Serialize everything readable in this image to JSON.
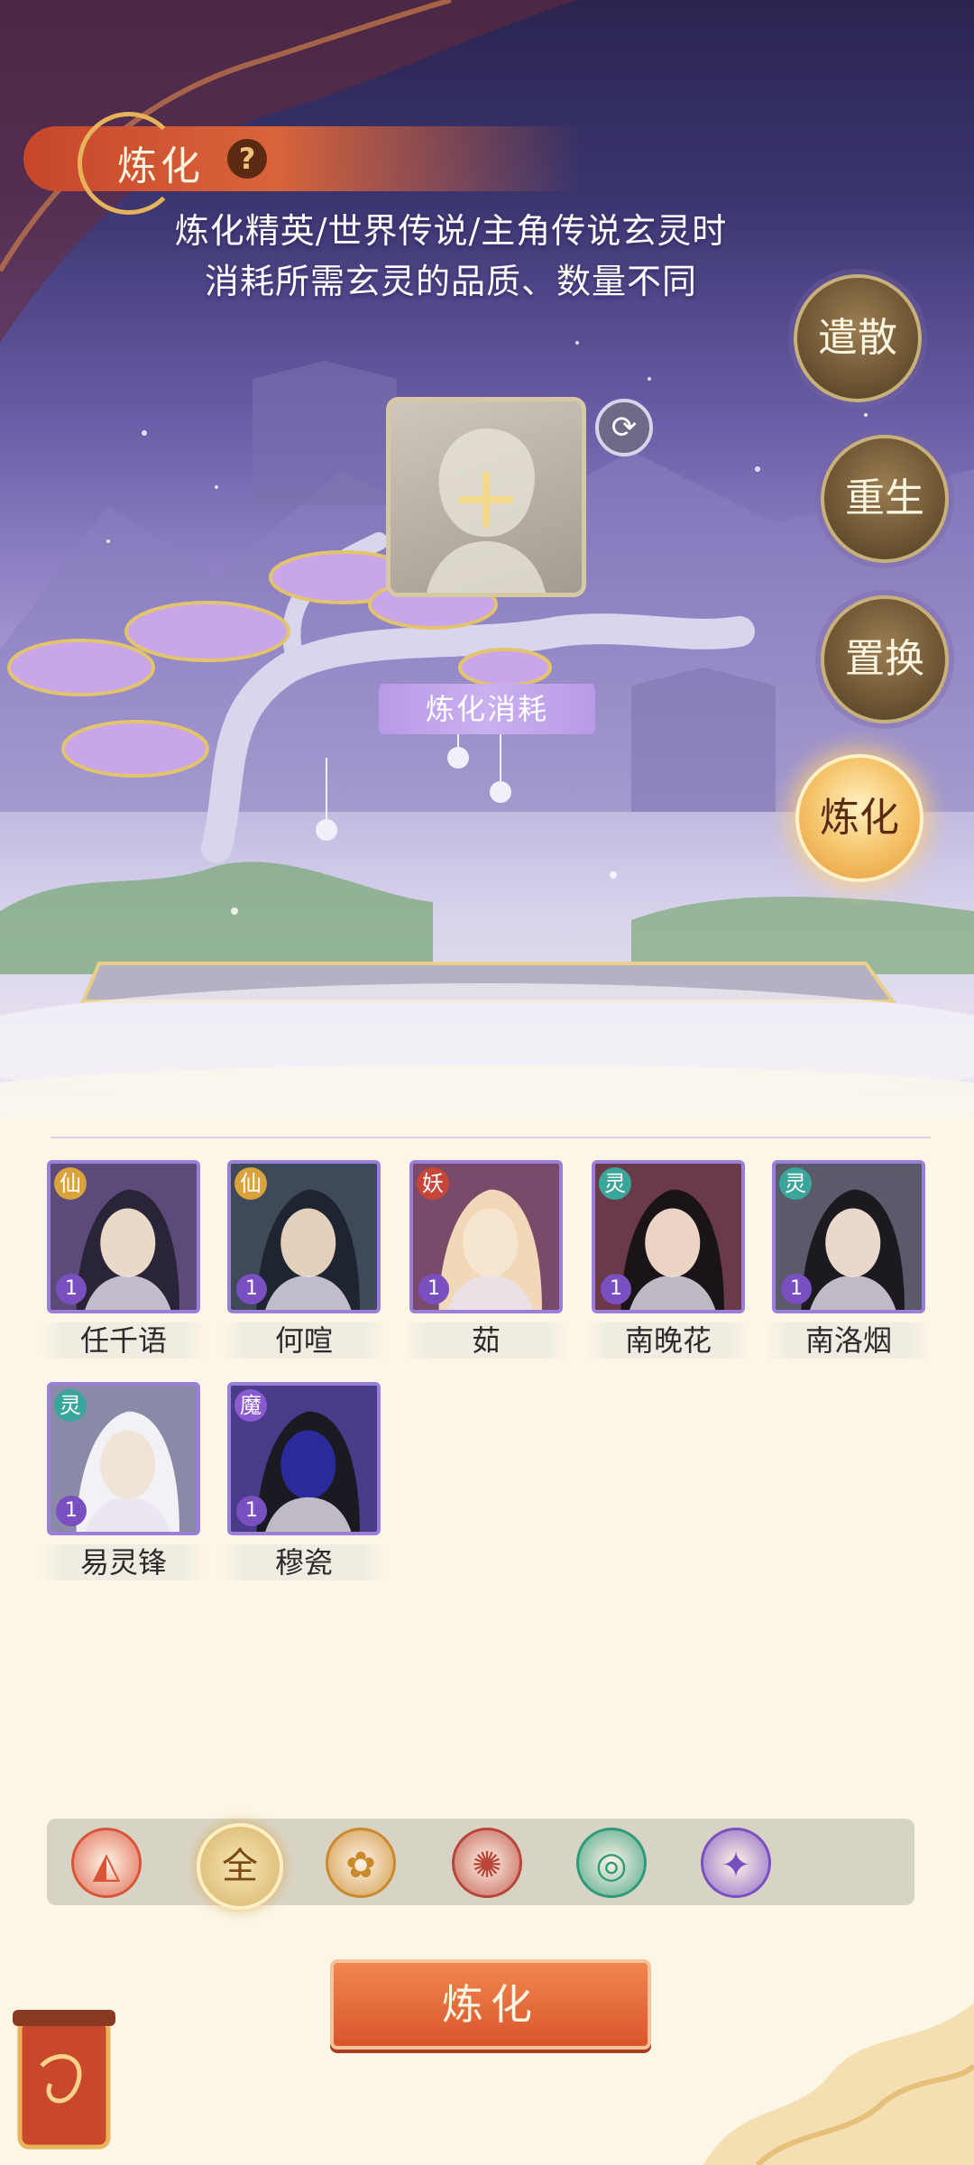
{
  "header": {
    "title": "炼化",
    "help_icon": "question-icon",
    "description_line1": "炼化精英/世界传说/主角传说玄灵时",
    "description_line2": "消耗所需玄灵的品质、数量不同"
  },
  "side_menu": [
    {
      "label": "遣散",
      "active": false
    },
    {
      "label": "重生",
      "active": false
    },
    {
      "label": "置换",
      "active": false
    },
    {
      "label": "炼化",
      "active": true
    }
  ],
  "slot": {
    "plus_icon": "plus-icon",
    "plus_glyph": "+",
    "swap_icon": "swap-icon",
    "swap_glyph": "⟳",
    "cost_label": "炼化消耗"
  },
  "characters": [
    {
      "name": "任千语",
      "faction": "仙",
      "faction_color": "#d9a23a",
      "level": "1"
    },
    {
      "name": "何喧",
      "faction": "仙",
      "faction_color": "#d9a23a",
      "level": "1"
    },
    {
      "name": "茹",
      "faction": "妖",
      "faction_color": "#c8453a",
      "level": "1"
    },
    {
      "name": "南晚花",
      "faction": "灵",
      "faction_color": "#3aa59a",
      "level": "1"
    },
    {
      "name": "南洛烟",
      "faction": "灵",
      "faction_color": "#3aa59a",
      "level": "1"
    },
    {
      "name": "易灵锋",
      "faction": "灵",
      "faction_color": "#3aa59a",
      "level": "1"
    },
    {
      "name": "穆瓷",
      "faction": "魔",
      "faction_color": "#8a5ad0",
      "level": "1"
    }
  ],
  "filters": [
    {
      "icon": "fire-emblem-icon",
      "glyph": "◭",
      "color": "#d9553a",
      "selected": false
    },
    {
      "icon": "all-icon",
      "glyph": "全",
      "color": "#7a4a12",
      "selected": true
    },
    {
      "icon": "lotus-icon",
      "glyph": "✿",
      "color": "#c98a2e",
      "selected": false
    },
    {
      "icon": "demon-emblem-icon",
      "glyph": "✺",
      "color": "#b8453a",
      "selected": false
    },
    {
      "icon": "spirit-swirl-icon",
      "glyph": "◎",
      "color": "#2e9a7a",
      "selected": false
    },
    {
      "icon": "crystal-icon",
      "glyph": "✦",
      "color": "#7a4fc0",
      "selected": false
    }
  ],
  "action": {
    "label": "炼化"
  }
}
